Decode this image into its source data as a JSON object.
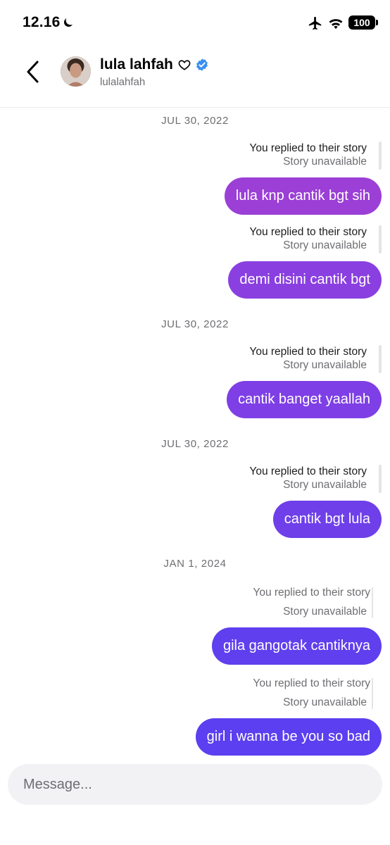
{
  "status_bar": {
    "time": "12.16",
    "battery": "100",
    "icons": [
      "moon-icon",
      "airplane-icon",
      "wifi-icon",
      "battery-icon"
    ]
  },
  "header": {
    "back_icon": "chevron-left-icon",
    "name": "lula lahfah",
    "name_icons": [
      "heart-outline-icon",
      "verified-badge-icon"
    ],
    "username": "lulalahfah"
  },
  "messages": {
    "date_1": "JUL 30, 2022",
    "reply_1": {
      "label": "You replied to their story",
      "status": "Story unavailable",
      "text": "lula knp cantik bgt sih"
    },
    "reply_2": {
      "label": "You replied to their story",
      "status": "Story unavailable",
      "text": "demi disini cantik bgt"
    },
    "date_2": "JUL 30, 2022",
    "reply_3": {
      "label": "You replied to their story",
      "status": "Story unavailable",
      "text": "cantik banget yaallah"
    },
    "date_3": "JUL 30, 2022",
    "reply_4": {
      "label": "You replied to their story",
      "status": "Story unavailable",
      "text": "cantik bgt lula"
    },
    "date_4": "JAN 1, 2024",
    "reply_5": {
      "label": "You replied to their story",
      "status": "Story unavailable",
      "text": "gila gangotak cantiknya"
    },
    "reply_6": {
      "label": "You replied to their story",
      "status": "Story unavailable",
      "text": "girl i wanna be you so bad"
    }
  },
  "composer": {
    "placeholder": "Message..."
  },
  "colors": {
    "bubble_top": "#9b3fd6",
    "bubble_mid": "#7e3fe6",
    "bubble_bottom": "#5b3ff0",
    "meta_gray": "#6e6e73",
    "verified_blue": "#3b8ff0"
  }
}
